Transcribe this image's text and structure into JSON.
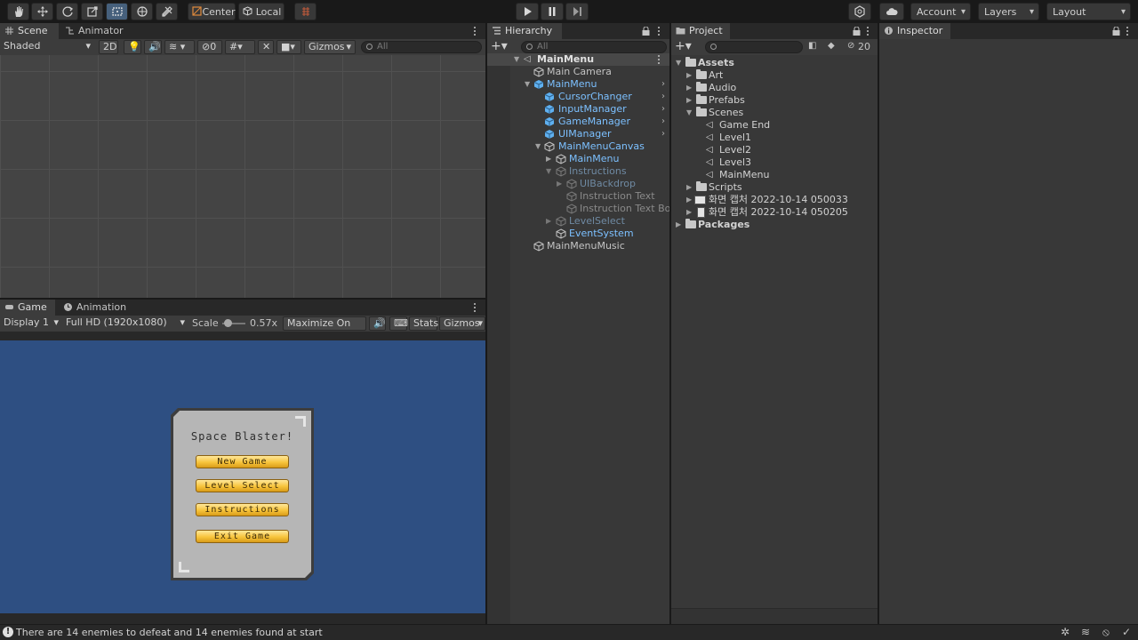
{
  "toolbar": {
    "pivot_center": "Center",
    "pivot_local": "Local",
    "account": "Account",
    "layers": "Layers",
    "layout": "Layout"
  },
  "scene": {
    "tab_scene": "Scene",
    "tab_animator": "Animator",
    "shading_mode": "Shaded",
    "btn_2d": "2D",
    "hidden_count": "0",
    "gizmos": "Gizmos",
    "search_placeholder": "All"
  },
  "game": {
    "tab_game": "Game",
    "tab_animation": "Animation",
    "display": "Display 1",
    "resolution": "Full HD (1920x1080)",
    "scale_label": "Scale",
    "scale_value": "0.57x",
    "scale_fraction": 0.1,
    "maximize": "Maximize On Play",
    "stats": "Stats",
    "gizmos": "Gizmos",
    "menu_title": "Space Blaster!",
    "buttons": [
      "New Game",
      "Level Select",
      "Instructions",
      "Exit Game"
    ],
    "bg_color": "#2e4f82"
  },
  "hierarchy": {
    "tab": "Hierarchy",
    "search_placeholder": "All",
    "scene_name": "MainMenu",
    "items": [
      {
        "label": "Main Camera"
      },
      {
        "label": "MainMenu"
      },
      {
        "label": "CursorChanger"
      },
      {
        "label": "InputManager"
      },
      {
        "label": "GameManager"
      },
      {
        "label": "UIManager"
      },
      {
        "label": "MainMenuCanvas"
      },
      {
        "label": "MainMenu"
      },
      {
        "label": "Instructions"
      },
      {
        "label": "UIBackdrop"
      },
      {
        "label": "Instruction Text"
      },
      {
        "label": "Instruction Text Body"
      },
      {
        "label": "LevelSelect"
      },
      {
        "label": "EventSystem"
      },
      {
        "label": "MainMenuMusic"
      }
    ]
  },
  "project": {
    "tab": "Project",
    "hidden_count": "20",
    "items": [
      {
        "label": "Assets"
      },
      {
        "label": "Art"
      },
      {
        "label": "Audio"
      },
      {
        "label": "Prefabs"
      },
      {
        "label": "Scenes"
      },
      {
        "label": "Game End"
      },
      {
        "label": "Level1"
      },
      {
        "label": "Level2"
      },
      {
        "label": "Level3"
      },
      {
        "label": "MainMenu"
      },
      {
        "label": "Scripts"
      },
      {
        "label": "화면 캡처 2022-10-14 050033"
      },
      {
        "label": "화면 캡처 2022-10-14 050205"
      },
      {
        "label": "Packages"
      }
    ]
  },
  "inspector": {
    "tab": "Inspector"
  },
  "status": {
    "message": "There are 14 enemies to defeat and 14 enemies found at start"
  },
  "colors": {
    "accent": "#7cc0ff",
    "panel": "#383838",
    "selected": "#46607c"
  }
}
